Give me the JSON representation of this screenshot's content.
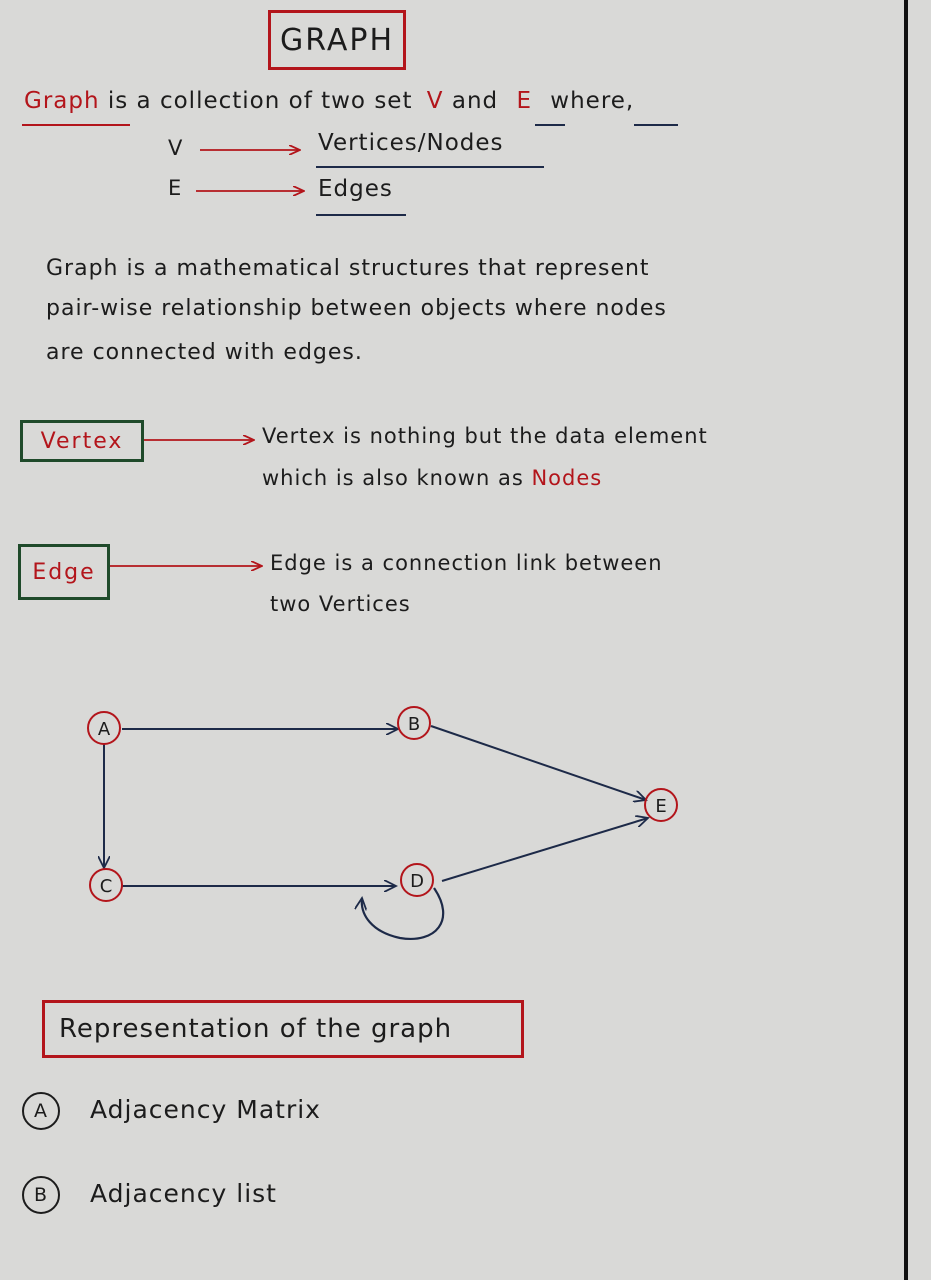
{
  "title": "GRAPH",
  "definition": {
    "graph_word": "Graph",
    "text": "is a collection of two set",
    "v_letter": "V",
    "and_word": "and",
    "e_letter": "E",
    "where_word": "where,",
    "rows": [
      {
        "symbol": "V",
        "meaning": "Vertices/Nodes"
      },
      {
        "symbol": "E",
        "meaning": "Edges"
      }
    ]
  },
  "description": [
    "Graph is a mathematical structures that represent",
    "pair-wise relationship between objects where nodes",
    "are connected with edges."
  ],
  "vertex": {
    "label": "Vertex",
    "line1": "Vertex is nothing but the data element",
    "line2_prefix": "which is also known as",
    "line2_highlight": "Nodes"
  },
  "edge": {
    "label": "Edge",
    "line1": "Edge is a connection link between",
    "line2": "two Vertices"
  },
  "graph_nodes": [
    "A",
    "B",
    "C",
    "D",
    "E"
  ],
  "representation": {
    "heading": "Representation of the graph",
    "items": [
      {
        "marker": "A",
        "text": "Adjacency Matrix"
      },
      {
        "marker": "B",
        "text": "Adjacency list"
      }
    ]
  },
  "colors": {
    "accent_red": "#b3151b",
    "box_green": "#1f4a2a",
    "ink_blue": "#1d2a48",
    "paper": "#d9d9d7"
  }
}
